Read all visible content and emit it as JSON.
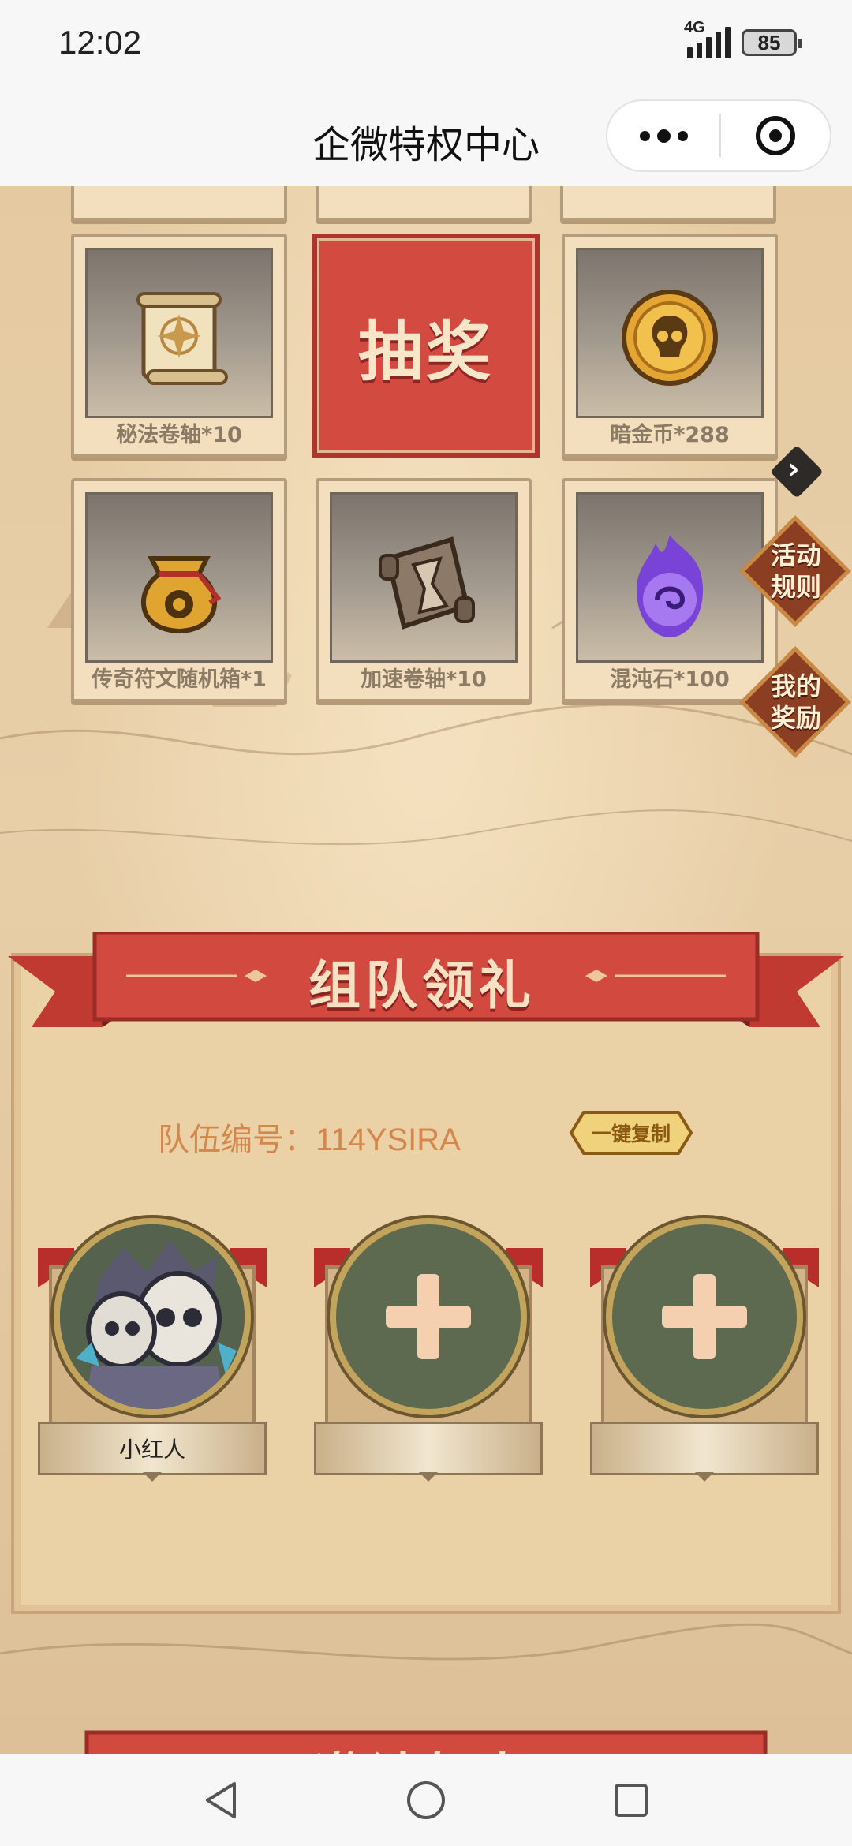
{
  "status_bar": {
    "time": "12:02",
    "network": "4G",
    "battery": "85"
  },
  "title_bar": {
    "title": "企微特权中心",
    "more_icon": "more-dots-icon",
    "close_icon": "target-close-icon"
  },
  "prize_grid": {
    "items": [
      {
        "label": "秘法卷轴*10",
        "icon": "scroll-icon"
      },
      {
        "label": "暗金币*288",
        "icon": "skull-coin-icon"
      },
      {
        "label": "传奇符文随机箱*1",
        "icon": "rune-bag-icon"
      },
      {
        "label": "加速卷轴*10",
        "icon": "hourglass-scroll-icon"
      },
      {
        "label": "混沌石*100",
        "icon": "chaos-stone-icon"
      }
    ],
    "draw_label": "抽奖"
  },
  "side_buttons": {
    "rules": "活动\n规则",
    "rewards": "我的\n奖励"
  },
  "team": {
    "title": "组队领礼",
    "team_id_text": "队伍编号：114YSIRA",
    "copy_label": "一键复制",
    "members": [
      {
        "name": "小红人",
        "filled": true
      },
      {
        "name": "",
        "filled": false
      },
      {
        "name": "",
        "filled": false
      }
    ]
  },
  "invite": {
    "title": "邀请好友"
  },
  "colors": {
    "accent_red": "#d34a40",
    "parchment": "#e5caa1",
    "team_id": "#d4874c"
  }
}
